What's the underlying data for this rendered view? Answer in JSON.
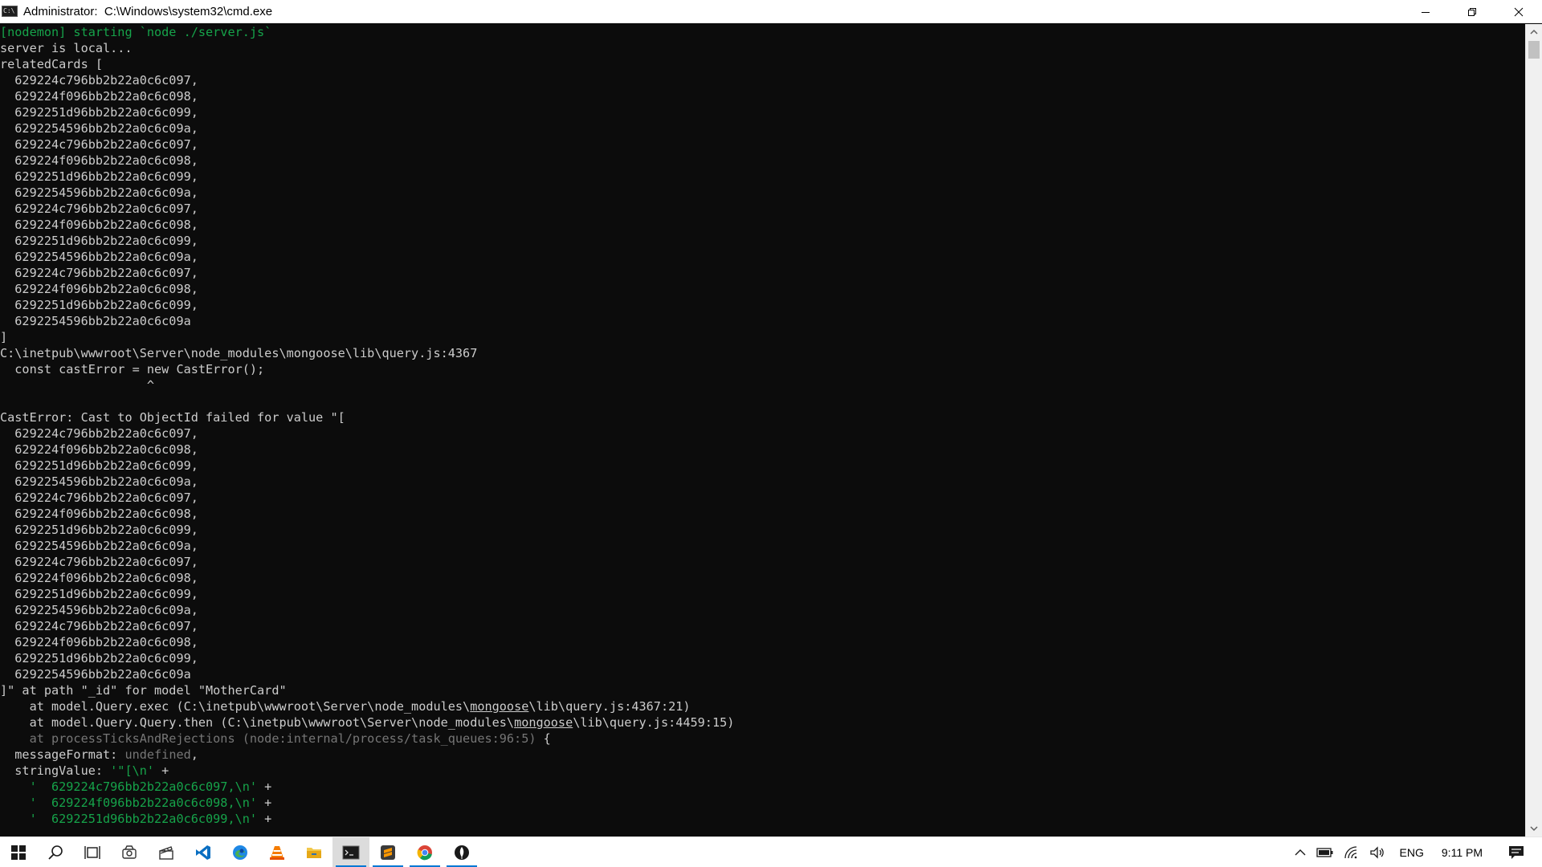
{
  "window": {
    "title": "Administrator:  C:\\Windows\\system32\\cmd.exe",
    "controls": {
      "minimize": "minimize",
      "restore": "restore",
      "close": "close"
    }
  },
  "colors": {
    "console_bg": "#0c0c0c",
    "console_text": "#cccccc",
    "green": "#16a34a",
    "gray": "#767676",
    "taskbar_accent": "#0078d4"
  },
  "console": {
    "lines": [
      {
        "segments": [
          {
            "text": "[nodemon] starting `node ./server.js`",
            "style": "green"
          }
        ]
      },
      {
        "segments": [
          {
            "text": "server is local...",
            "style": "normal"
          }
        ]
      },
      {
        "segments": [
          {
            "text": "relatedCards [",
            "style": "normal"
          }
        ]
      },
      {
        "segments": [
          {
            "text": "  629224c796bb2b22a0c6c097,",
            "style": "normal"
          }
        ]
      },
      {
        "segments": [
          {
            "text": "  629224f096bb2b22a0c6c098,",
            "style": "normal"
          }
        ]
      },
      {
        "segments": [
          {
            "text": "  6292251d96bb2b22a0c6c099,",
            "style": "normal"
          }
        ]
      },
      {
        "segments": [
          {
            "text": "  6292254596bb2b22a0c6c09a,",
            "style": "normal"
          }
        ]
      },
      {
        "segments": [
          {
            "text": "  629224c796bb2b22a0c6c097,",
            "style": "normal"
          }
        ]
      },
      {
        "segments": [
          {
            "text": "  629224f096bb2b22a0c6c098,",
            "style": "normal"
          }
        ]
      },
      {
        "segments": [
          {
            "text": "  6292251d96bb2b22a0c6c099,",
            "style": "normal"
          }
        ]
      },
      {
        "segments": [
          {
            "text": "  6292254596bb2b22a0c6c09a,",
            "style": "normal"
          }
        ]
      },
      {
        "segments": [
          {
            "text": "  629224c796bb2b22a0c6c097,",
            "style": "normal"
          }
        ]
      },
      {
        "segments": [
          {
            "text": "  629224f096bb2b22a0c6c098,",
            "style": "normal"
          }
        ]
      },
      {
        "segments": [
          {
            "text": "  6292251d96bb2b22a0c6c099,",
            "style": "normal"
          }
        ]
      },
      {
        "segments": [
          {
            "text": "  6292254596bb2b22a0c6c09a,",
            "style": "normal"
          }
        ]
      },
      {
        "segments": [
          {
            "text": "  629224c796bb2b22a0c6c097,",
            "style": "normal"
          }
        ]
      },
      {
        "segments": [
          {
            "text": "  629224f096bb2b22a0c6c098,",
            "style": "normal"
          }
        ]
      },
      {
        "segments": [
          {
            "text": "  6292251d96bb2b22a0c6c099,",
            "style": "normal"
          }
        ]
      },
      {
        "segments": [
          {
            "text": "  6292254596bb2b22a0c6c09a",
            "style": "normal"
          }
        ]
      },
      {
        "segments": [
          {
            "text": "]",
            "style": "normal"
          }
        ]
      },
      {
        "segments": [
          {
            "text": "C:\\inetpub\\wwwroot\\Server\\node_modules\\mongoose\\lib\\query.js:4367",
            "style": "normal"
          }
        ]
      },
      {
        "segments": [
          {
            "text": "  const castError = new CastError();",
            "style": "normal"
          }
        ]
      },
      {
        "segments": [
          {
            "text": "                    ^",
            "style": "normal"
          }
        ]
      },
      {
        "segments": [
          {
            "text": "",
            "style": "normal"
          }
        ]
      },
      {
        "segments": [
          {
            "text": "CastError: Cast to ObjectId failed for value \"[",
            "style": "normal"
          }
        ]
      },
      {
        "segments": [
          {
            "text": "  629224c796bb2b22a0c6c097,",
            "style": "normal"
          }
        ]
      },
      {
        "segments": [
          {
            "text": "  629224f096bb2b22a0c6c098,",
            "style": "normal"
          }
        ]
      },
      {
        "segments": [
          {
            "text": "  6292251d96bb2b22a0c6c099,",
            "style": "normal"
          }
        ]
      },
      {
        "segments": [
          {
            "text": "  6292254596bb2b22a0c6c09a,",
            "style": "normal"
          }
        ]
      },
      {
        "segments": [
          {
            "text": "  629224c796bb2b22a0c6c097,",
            "style": "normal"
          }
        ]
      },
      {
        "segments": [
          {
            "text": "  629224f096bb2b22a0c6c098,",
            "style": "normal"
          }
        ]
      },
      {
        "segments": [
          {
            "text": "  6292251d96bb2b22a0c6c099,",
            "style": "normal"
          }
        ]
      },
      {
        "segments": [
          {
            "text": "  6292254596bb2b22a0c6c09a,",
            "style": "normal"
          }
        ]
      },
      {
        "segments": [
          {
            "text": "  629224c796bb2b22a0c6c097,",
            "style": "normal"
          }
        ]
      },
      {
        "segments": [
          {
            "text": "  629224f096bb2b22a0c6c098,",
            "style": "normal"
          }
        ]
      },
      {
        "segments": [
          {
            "text": "  6292251d96bb2b22a0c6c099,",
            "style": "normal"
          }
        ]
      },
      {
        "segments": [
          {
            "text": "  6292254596bb2b22a0c6c09a,",
            "style": "normal"
          }
        ]
      },
      {
        "segments": [
          {
            "text": "  629224c796bb2b22a0c6c097,",
            "style": "normal"
          }
        ]
      },
      {
        "segments": [
          {
            "text": "  629224f096bb2b22a0c6c098,",
            "style": "normal"
          }
        ]
      },
      {
        "segments": [
          {
            "text": "  6292251d96bb2b22a0c6c099,",
            "style": "normal"
          }
        ]
      },
      {
        "segments": [
          {
            "text": "  6292254596bb2b22a0c6c09a",
            "style": "normal"
          }
        ]
      },
      {
        "segments": [
          {
            "text": "]\" at path \"_id\" for model \"MotherCard\"",
            "style": "normal"
          }
        ]
      },
      {
        "segments": [
          {
            "text": "    at model.Query.exec (C:\\inetpub\\wwwroot\\Server\\node_modules\\",
            "style": "normal"
          },
          {
            "text": "mongoose",
            "style": "underline"
          },
          {
            "text": "\\lib\\query.js:4367:21)",
            "style": "normal"
          }
        ]
      },
      {
        "segments": [
          {
            "text": "    at model.Query.Query.then (C:\\inetpub\\wwwroot\\Server\\node_modules\\",
            "style": "normal"
          },
          {
            "text": "mongoose",
            "style": "underline"
          },
          {
            "text": "\\lib\\query.js:4459:15)",
            "style": "normal"
          }
        ]
      },
      {
        "segments": [
          {
            "text": "    at processTicksAndRejections (node:internal/process/task_queues:96:5)",
            "style": "gray"
          },
          {
            "text": " {",
            "style": "normal"
          }
        ]
      },
      {
        "segments": [
          {
            "text": "  messageFormat: ",
            "style": "normal"
          },
          {
            "text": "undefined",
            "style": "gray"
          },
          {
            "text": ",",
            "style": "normal"
          }
        ]
      },
      {
        "segments": [
          {
            "text": "  stringValue: ",
            "style": "normal"
          },
          {
            "text": "'\"[\\n'",
            "style": "green"
          },
          {
            "text": " +",
            "style": "normal"
          }
        ]
      },
      {
        "segments": [
          {
            "text": "    '  629224c796bb2b22a0c6c097,\\n'",
            "style": "green"
          },
          {
            "text": " +",
            "style": "normal"
          }
        ]
      },
      {
        "segments": [
          {
            "text": "    '  629224f096bb2b22a0c6c098,\\n'",
            "style": "green"
          },
          {
            "text": " +",
            "style": "normal"
          }
        ]
      },
      {
        "segments": [
          {
            "text": "    '  6292251d96bb2b22a0c6c099,\\n'",
            "style": "green"
          },
          {
            "text": " +",
            "style": "normal"
          }
        ]
      }
    ]
  },
  "taskbar": {
    "apps": [
      {
        "icon": "windows-start-icon",
        "name": "start-button"
      },
      {
        "icon": "search-icon",
        "name": "search-button"
      },
      {
        "icon": "task-view-icon",
        "name": "task-view-button"
      },
      {
        "icon": "app-icon",
        "name": "taskbar-app-1"
      },
      {
        "icon": "clapper-icon",
        "name": "taskbar-app-2"
      },
      {
        "icon": "vscode-icon",
        "name": "taskbar-vscode"
      },
      {
        "icon": "edge-icon",
        "name": "taskbar-edge"
      },
      {
        "icon": "vlc-icon",
        "name": "taskbar-vlc"
      },
      {
        "icon": "folder-icon",
        "name": "taskbar-file-explorer"
      },
      {
        "icon": "cmd-icon",
        "name": "taskbar-cmd"
      },
      {
        "icon": "sublime-icon",
        "name": "taskbar-sublime"
      },
      {
        "icon": "chrome-icon",
        "name": "taskbar-chrome"
      },
      {
        "icon": "mongodb-icon",
        "name": "taskbar-mongodb"
      }
    ],
    "tray": {
      "language": "ENG",
      "time": "9:11 PM"
    }
  }
}
